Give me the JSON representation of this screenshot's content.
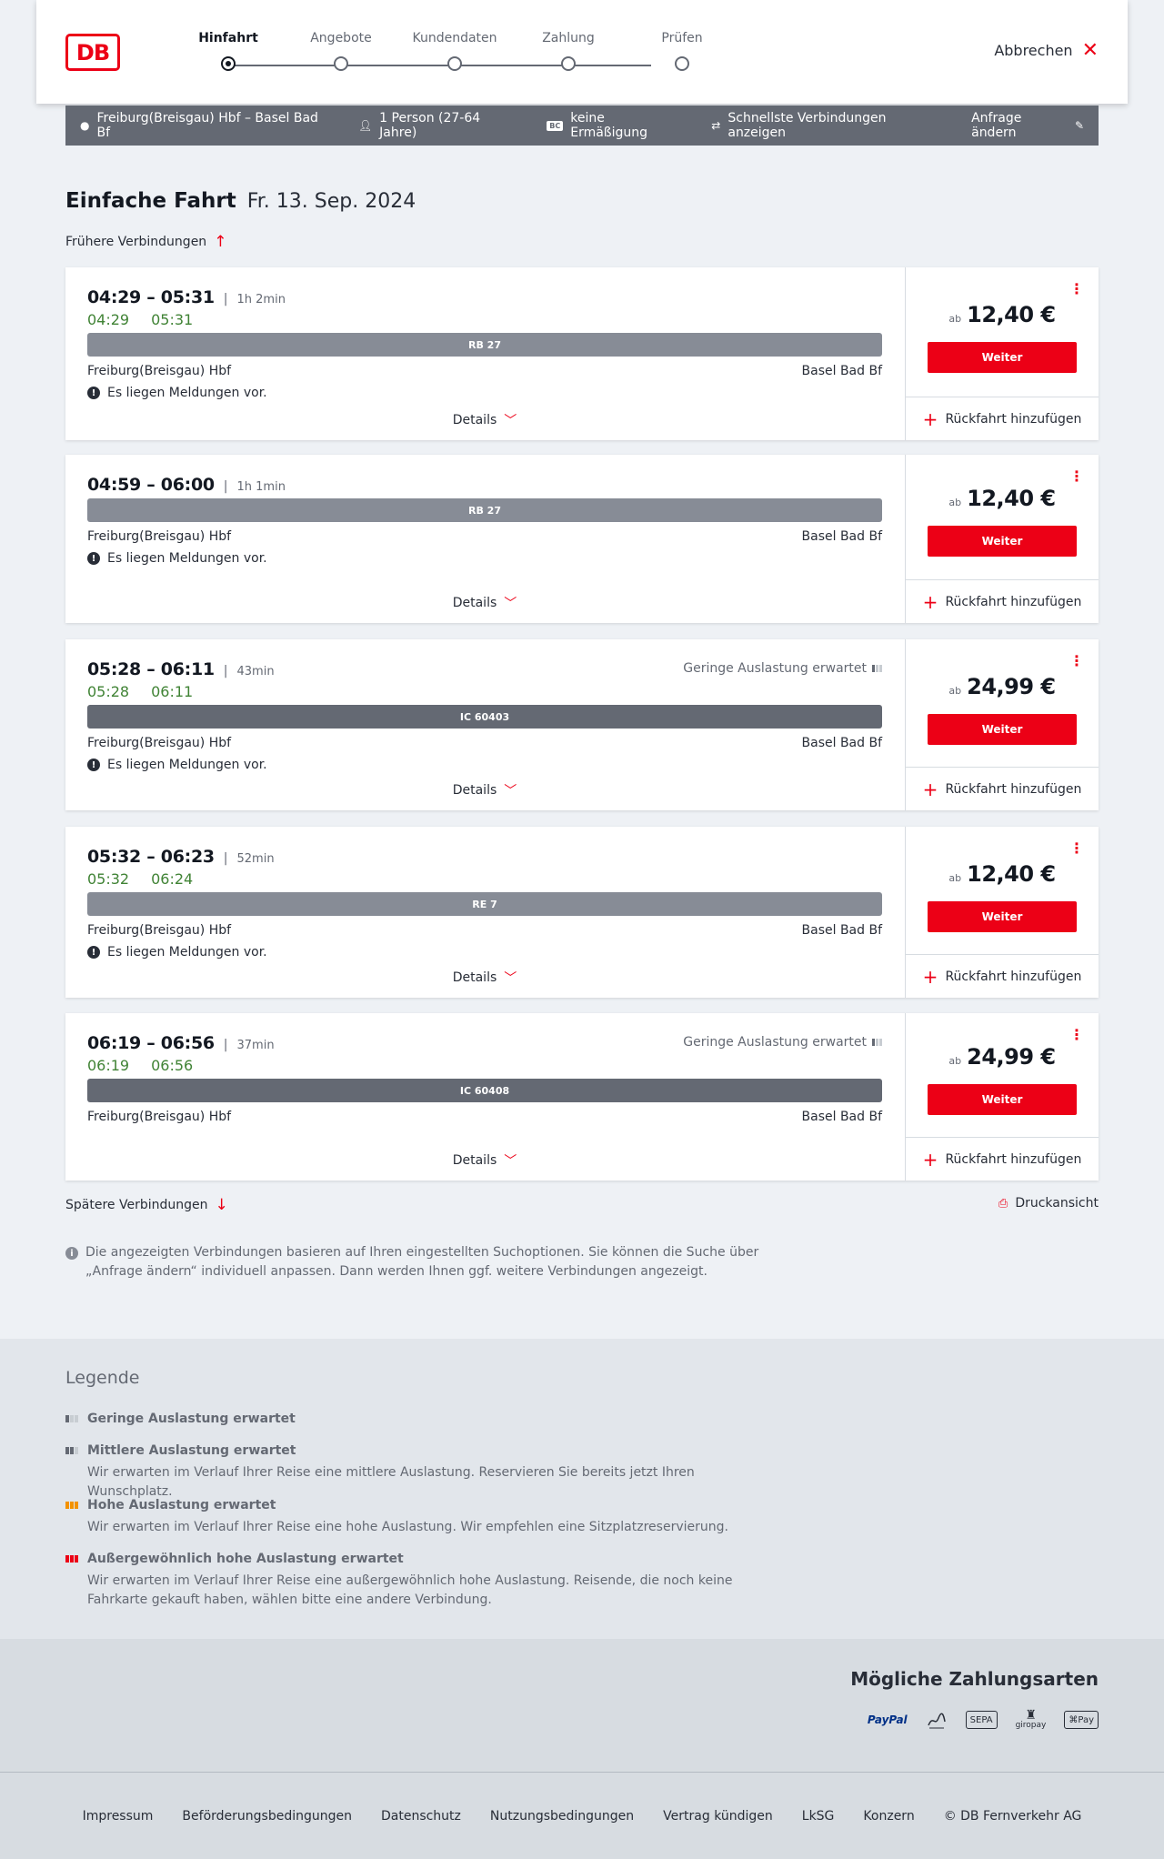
{
  "header": {
    "logo": "DB",
    "steps": [
      "Hinfahrt",
      "Angebote",
      "Kundendaten",
      "Zahlung",
      "Prüfen"
    ],
    "active_step": 0,
    "cancel_label": "Abbrechen"
  },
  "infobar": {
    "route": "Freiburg(Breisgau) Hbf – Basel Bad Bf",
    "travellers": "1 Person (27-64 Jahre)",
    "bc_badge": "BC",
    "discount": "keine Ermäßigung",
    "fastest": "Schnellste Verbindungen anzeigen",
    "change": "Anfrage ändern"
  },
  "title": {
    "trip_type": "Einfache Fahrt",
    "date": "Fr. 13. Sep. 2024"
  },
  "earlier_label": "Frühere Verbindungen",
  "later_label": "Spätere Verbindungen",
  "print_label": "Druckansicht",
  "labels": {
    "details": "Details",
    "weiter": "Weiter",
    "return": "Rückfahrt hinzufügen",
    "ab": "ab",
    "message": "Es liegen Meldungen vor."
  },
  "connections": [
    {
      "times": "04:29 – 05:31",
      "duration": "1h 2min",
      "actual_dep": "04:29",
      "actual_arr": "05:31",
      "train": "RB 27",
      "train_kind": "regional",
      "from": "Freiburg(Breisgau) Hbf",
      "to": "Basel Bad Bf",
      "has_message": true,
      "load": "",
      "price": "12,40 €"
    },
    {
      "times": "04:59 – 06:00",
      "duration": "1h 1min",
      "actual_dep": "",
      "actual_arr": "",
      "train": "RB 27",
      "train_kind": "regional",
      "from": "Freiburg(Breisgau) Hbf",
      "to": "Basel Bad Bf",
      "has_message": true,
      "load": "",
      "price": "12,40 €"
    },
    {
      "times": "05:28 – 06:11",
      "duration": "43min",
      "actual_dep": "05:28",
      "actual_arr": "06:11",
      "train": "IC 60403",
      "train_kind": "ic",
      "from": "Freiburg(Breisgau) Hbf",
      "to": "Basel Bad Bf",
      "has_message": true,
      "load": "Geringe Auslastung erwartet",
      "price": "24,99 €"
    },
    {
      "times": "05:32 – 06:23",
      "duration": "52min",
      "actual_dep": "05:32",
      "actual_arr": "06:24",
      "train": "RE 7",
      "train_kind": "regional",
      "from": "Freiburg(Breisgau) Hbf",
      "to": "Basel Bad Bf",
      "has_message": true,
      "load": "",
      "price": "12,40 €"
    },
    {
      "times": "06:19 – 06:56",
      "duration": "37min",
      "actual_dep": "06:19",
      "actual_arr": "06:56",
      "train": "IC 60408",
      "train_kind": "ic",
      "from": "Freiburg(Breisgau) Hbf",
      "to": "Basel Bad Bf",
      "has_message": false,
      "load": "Geringe Auslastung erwartet",
      "price": "24,99 €"
    }
  ],
  "note": "Die angezeigten Verbindungen basieren auf Ihren eingestellten Suchoptionen. Sie können die Suche über „Anfrage ändern“ individuell anpassen. Dann werden Ihnen ggf. weitere Verbindungen angezeigt.",
  "legend": {
    "title": "Legende",
    "items": [
      {
        "title": "Geringe Auslastung erwartet",
        "desc": "",
        "icon_color": "#646973",
        "level": 1
      },
      {
        "title": "Mittlere Auslastung erwartet",
        "desc": "Wir erwarten im Verlauf Ihrer Reise eine mittlere Auslastung. Reservieren Sie bereits jetzt Ihren Wunschplatz.",
        "icon_color": "#646973",
        "level": 2
      },
      {
        "title": "Hohe Auslastung erwartet",
        "desc": "Wir erwarten im Verlauf Ihrer Reise eine hohe Auslastung. Wir empfehlen eine Sitzplatzreservierung.",
        "icon_color": "#f39200",
        "level": 3
      },
      {
        "title": "Außergewöhnlich hohe Auslastung erwartet",
        "desc": "Wir erwarten im Verlauf Ihrer Reise eine außergewöhnlich hohe Auslastung. Reisende, die noch keine Fahrkarte gekauft haben, wählen bitte eine andere Verbindung.",
        "icon_color": "#ec0016",
        "level": 4
      }
    ]
  },
  "payment": {
    "title": "Mögliche Zahlungsarten",
    "methods": [
      "PayPal",
      "SEPA",
      "giropay",
      "Pay"
    ]
  },
  "footer": {
    "links": [
      "Impressum",
      "Beförderungsbedingungen",
      "Datenschutz",
      "Nutzungsbedingungen",
      "Vertrag kündigen",
      "LkSG",
      "Konzern",
      "© DB Fernverkehr AG"
    ]
  },
  "colors": {
    "db_red": "#ec0016",
    "on_time_green": "#408335",
    "ic_bar": "#646973",
    "regional_bar": "#878c96"
  }
}
